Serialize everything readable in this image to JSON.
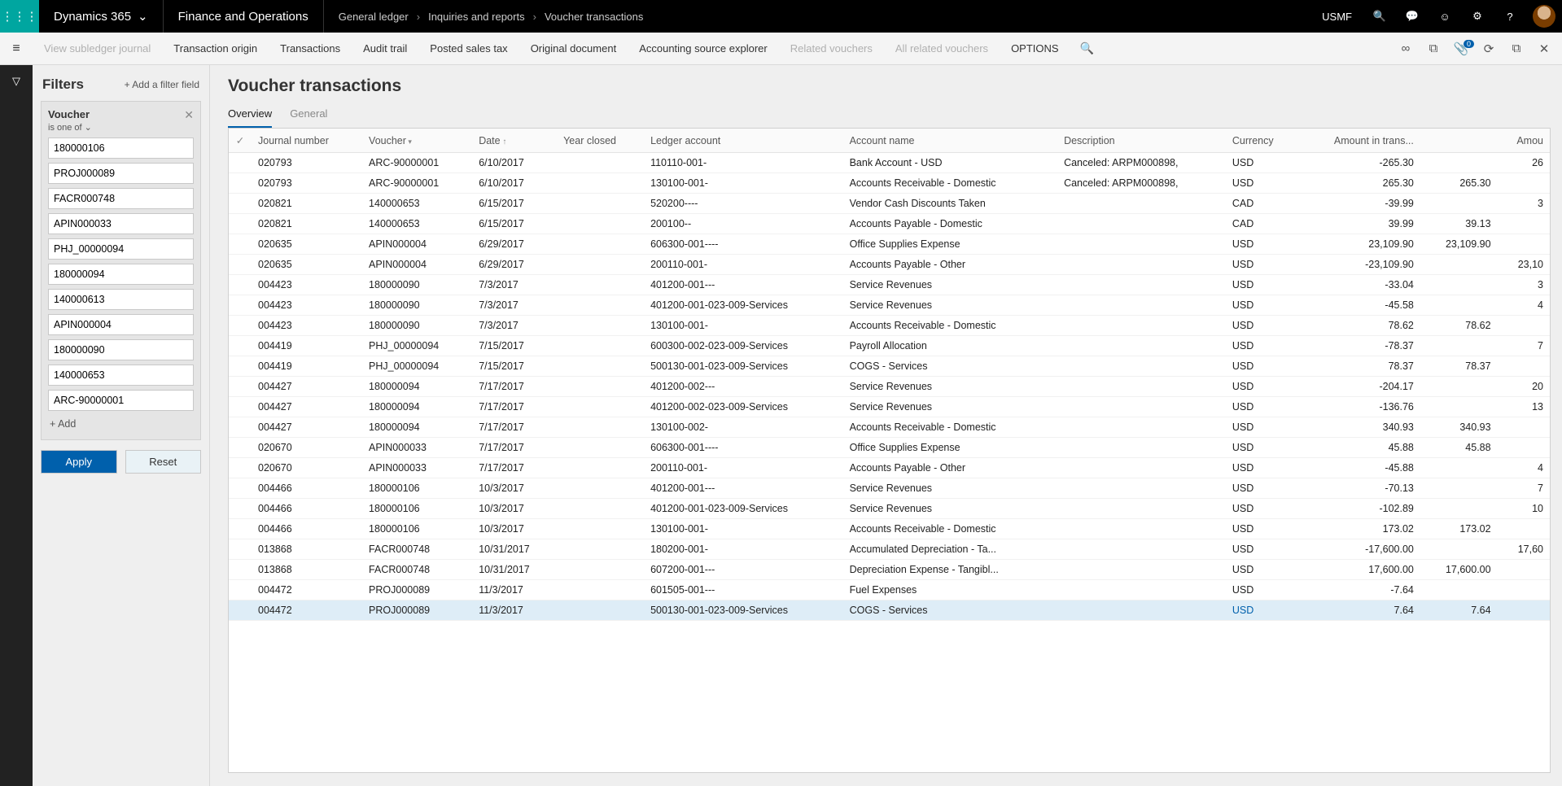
{
  "topbar": {
    "brand": "Dynamics 365",
    "app": "Finance and Operations",
    "crumbs": [
      "General ledger",
      "Inquiries and reports",
      "Voucher transactions"
    ],
    "company": "USMF"
  },
  "actionbar": {
    "items": [
      {
        "label": "View subledger journal",
        "disabled": true
      },
      {
        "label": "Transaction origin",
        "disabled": false
      },
      {
        "label": "Transactions",
        "disabled": false
      },
      {
        "label": "Audit trail",
        "disabled": false
      },
      {
        "label": "Posted sales tax",
        "disabled": false
      },
      {
        "label": "Original document",
        "disabled": false
      },
      {
        "label": "Accounting source explorer",
        "disabled": false
      },
      {
        "label": "Related vouchers",
        "disabled": true
      },
      {
        "label": "All related vouchers",
        "disabled": true
      },
      {
        "label": "OPTIONS",
        "disabled": false
      }
    ],
    "attach_badge": "0"
  },
  "filters": {
    "title": "Filters",
    "add_field": "Add a filter field",
    "card": {
      "name": "Voucher",
      "op": "is one of ⌄",
      "values": [
        "180000106",
        "PROJ000089",
        "FACR000748",
        "APIN000033",
        "PHJ_00000094",
        "180000094",
        "140000613",
        "APIN000004",
        "180000090",
        "140000653",
        "ARC-90000001"
      ],
      "add": "Add"
    },
    "apply": "Apply",
    "reset": "Reset"
  },
  "main": {
    "title": "Voucher transactions",
    "tabs": [
      {
        "label": "Overview",
        "active": true
      },
      {
        "label": "General",
        "active": false
      }
    ],
    "columns": [
      "",
      "Journal number",
      "Voucher",
      "Date",
      "Year closed",
      "Ledger account",
      "Account name",
      "Description",
      "Currency",
      "Amount in trans...",
      "",
      "Amou"
    ],
    "sort_col": "Date",
    "filter_col": "Voucher",
    "rows": [
      {
        "jn": "020793",
        "v": "ARC-90000001",
        "d": "6/10/2017",
        "yc": "",
        "la": "110110-001-",
        "an": "Bank Account - USD",
        "desc": "Canceled: ARPM000898,",
        "cur": "USD",
        "a1": "-265.30",
        "a2": "",
        "a3": "26"
      },
      {
        "jn": "020793",
        "v": "ARC-90000001",
        "d": "6/10/2017",
        "yc": "",
        "la": "130100-001-",
        "an": "Accounts Receivable - Domestic",
        "desc": "Canceled: ARPM000898,",
        "cur": "USD",
        "a1": "265.30",
        "a2": "265.30",
        "a3": ""
      },
      {
        "jn": "020821",
        "v": "140000653",
        "d": "6/15/2017",
        "yc": "",
        "la": "520200----",
        "an": "Vendor Cash Discounts Taken",
        "desc": "",
        "cur": "CAD",
        "a1": "-39.99",
        "a2": "",
        "a3": "3"
      },
      {
        "jn": "020821",
        "v": "140000653",
        "d": "6/15/2017",
        "yc": "",
        "la": "200100--",
        "an": "Accounts Payable - Domestic",
        "desc": "",
        "cur": "CAD",
        "a1": "39.99",
        "a2": "39.13",
        "a3": ""
      },
      {
        "jn": "020635",
        "v": "APIN000004",
        "d": "6/29/2017",
        "yc": "",
        "la": "606300-001----",
        "an": "Office Supplies Expense",
        "desc": "",
        "cur": "USD",
        "a1": "23,109.90",
        "a2": "23,109.90",
        "a3": ""
      },
      {
        "jn": "020635",
        "v": "APIN000004",
        "d": "6/29/2017",
        "yc": "",
        "la": "200110-001-",
        "an": "Accounts Payable - Other",
        "desc": "",
        "cur": "USD",
        "a1": "-23,109.90",
        "a2": "",
        "a3": "23,10"
      },
      {
        "jn": "004423",
        "v": "180000090",
        "d": "7/3/2017",
        "yc": "",
        "la": "401200-001---",
        "an": "Service Revenues",
        "desc": "",
        "cur": "USD",
        "a1": "-33.04",
        "a2": "",
        "a3": "3"
      },
      {
        "jn": "004423",
        "v": "180000090",
        "d": "7/3/2017",
        "yc": "",
        "la": "401200-001-023-009-Services",
        "an": "Service Revenues",
        "desc": "",
        "cur": "USD",
        "a1": "-45.58",
        "a2": "",
        "a3": "4"
      },
      {
        "jn": "004423",
        "v": "180000090",
        "d": "7/3/2017",
        "yc": "",
        "la": "130100-001-",
        "an": "Accounts Receivable - Domestic",
        "desc": "",
        "cur": "USD",
        "a1": "78.62",
        "a2": "78.62",
        "a3": ""
      },
      {
        "jn": "004419",
        "v": "PHJ_00000094",
        "d": "7/15/2017",
        "yc": "",
        "la": "600300-002-023-009-Services",
        "an": "Payroll Allocation",
        "desc": "",
        "cur": "USD",
        "a1": "-78.37",
        "a2": "",
        "a3": "7"
      },
      {
        "jn": "004419",
        "v": "PHJ_00000094",
        "d": "7/15/2017",
        "yc": "",
        "la": "500130-001-023-009-Services",
        "an": "COGS - Services",
        "desc": "",
        "cur": "USD",
        "a1": "78.37",
        "a2": "78.37",
        "a3": ""
      },
      {
        "jn": "004427",
        "v": "180000094",
        "d": "7/17/2017",
        "yc": "",
        "la": "401200-002---",
        "an": "Service Revenues",
        "desc": "",
        "cur": "USD",
        "a1": "-204.17",
        "a2": "",
        "a3": "20"
      },
      {
        "jn": "004427",
        "v": "180000094",
        "d": "7/17/2017",
        "yc": "",
        "la": "401200-002-023-009-Services",
        "an": "Service Revenues",
        "desc": "",
        "cur": "USD",
        "a1": "-136.76",
        "a2": "",
        "a3": "13"
      },
      {
        "jn": "004427",
        "v": "180000094",
        "d": "7/17/2017",
        "yc": "",
        "la": "130100-002-",
        "an": "Accounts Receivable - Domestic",
        "desc": "",
        "cur": "USD",
        "a1": "340.93",
        "a2": "340.93",
        "a3": ""
      },
      {
        "jn": "020670",
        "v": "APIN000033",
        "d": "7/17/2017",
        "yc": "",
        "la": "606300-001----",
        "an": "Office Supplies Expense",
        "desc": "",
        "cur": "USD",
        "a1": "45.88",
        "a2": "45.88",
        "a3": ""
      },
      {
        "jn": "020670",
        "v": "APIN000033",
        "d": "7/17/2017",
        "yc": "",
        "la": "200110-001-",
        "an": "Accounts Payable - Other",
        "desc": "",
        "cur": "USD",
        "a1": "-45.88",
        "a2": "",
        "a3": "4"
      },
      {
        "jn": "004466",
        "v": "180000106",
        "d": "10/3/2017",
        "yc": "",
        "la": "401200-001---",
        "an": "Service Revenues",
        "desc": "",
        "cur": "USD",
        "a1": "-70.13",
        "a2": "",
        "a3": "7"
      },
      {
        "jn": "004466",
        "v": "180000106",
        "d": "10/3/2017",
        "yc": "",
        "la": "401200-001-023-009-Services",
        "an": "Service Revenues",
        "desc": "",
        "cur": "USD",
        "a1": "-102.89",
        "a2": "",
        "a3": "10"
      },
      {
        "jn": "004466",
        "v": "180000106",
        "d": "10/3/2017",
        "yc": "",
        "la": "130100-001-",
        "an": "Accounts Receivable - Domestic",
        "desc": "",
        "cur": "USD",
        "a1": "173.02",
        "a2": "173.02",
        "a3": ""
      },
      {
        "jn": "013868",
        "v": "FACR000748",
        "d": "10/31/2017",
        "yc": "",
        "la": "180200-001-",
        "an": "Accumulated Depreciation - Ta...",
        "desc": "",
        "cur": "USD",
        "a1": "-17,600.00",
        "a2": "",
        "a3": "17,60"
      },
      {
        "jn": "013868",
        "v": "FACR000748",
        "d": "10/31/2017",
        "yc": "",
        "la": "607200-001---",
        "an": "Depreciation Expense - Tangibl...",
        "desc": "",
        "cur": "USD",
        "a1": "17,600.00",
        "a2": "17,600.00",
        "a3": ""
      },
      {
        "jn": "004472",
        "v": "PROJ000089",
        "d": "11/3/2017",
        "yc": "",
        "la": "601505-001---",
        "an": "Fuel Expenses",
        "desc": "",
        "cur": "USD",
        "a1": "-7.64",
        "a2": "",
        "a3": ""
      },
      {
        "jn": "004472",
        "v": "PROJ000089",
        "d": "11/3/2017",
        "yc": "",
        "la": "500130-001-023-009-Services",
        "an": "COGS - Services",
        "desc": "",
        "cur": "USD",
        "a1": "7.64",
        "a2": "7.64",
        "a3": "",
        "sel": true
      }
    ]
  }
}
